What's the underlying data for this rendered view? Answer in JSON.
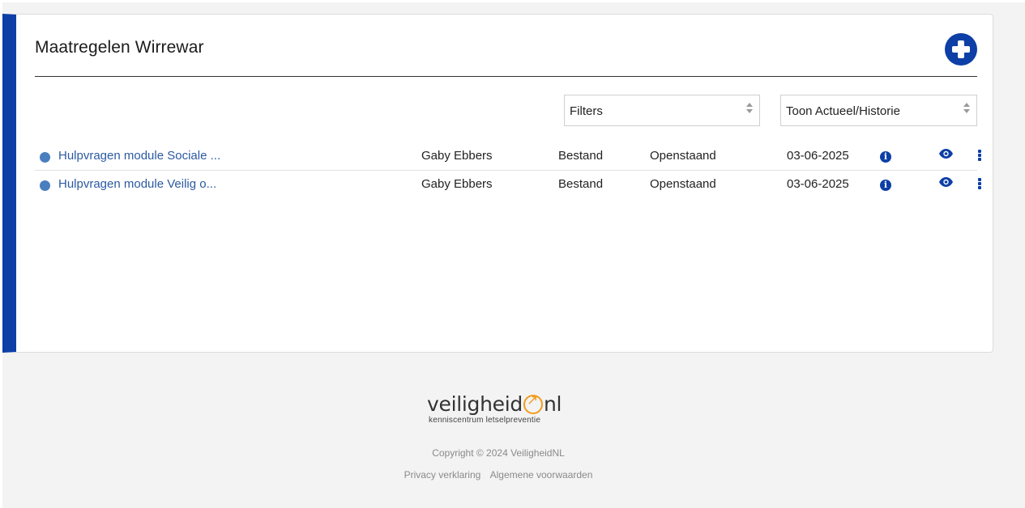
{
  "card": {
    "title": "Maatregelen Wirrewar",
    "add_icon": "plus-circle-icon",
    "accent_color": "#0d3fa6"
  },
  "filters": {
    "filters_label": "Filters",
    "toon_label": "Toon Actueel/Historie"
  },
  "rows": [
    {
      "title": "Hulpvragen module Sociale ...",
      "person": "Gaby Ebbers",
      "type": "Bestand",
      "status": "Openstaand",
      "date": "03-06-2025"
    },
    {
      "title": "Hulpvragen module Veilig o...",
      "person": "Gaby Ebbers",
      "type": "Bestand",
      "status": "Openstaand",
      "date": "03-06-2025"
    }
  ],
  "icons": {
    "info": "info-icon",
    "eye": "eye-icon",
    "menu": "kebab-menu-icon",
    "info_glyph": "i"
  },
  "footer": {
    "logo_main_1": "veiligheid",
    "logo_main_2": "nl",
    "logo_sub": "kenniscentrum letselpreventie",
    "copyright": "Copyright © 2024 VeiligheidNL",
    "privacy": "Privacy verklaring",
    "terms": "Algemene voorwaarden",
    "logo_color": "#f29b1e"
  }
}
